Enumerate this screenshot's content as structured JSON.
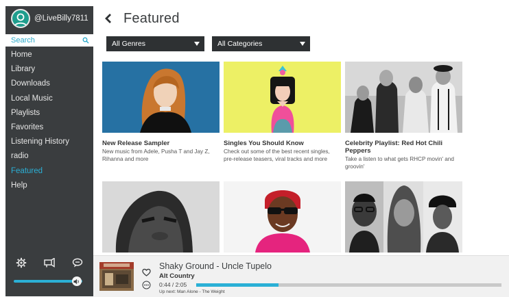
{
  "user": {
    "username": "@LiveBilly7811"
  },
  "search": {
    "placeholder": "Search"
  },
  "sidebar": {
    "items": [
      {
        "label": "Home"
      },
      {
        "label": "Library"
      },
      {
        "label": "Downloads"
      },
      {
        "label": "Local Music"
      },
      {
        "label": "Playlists"
      },
      {
        "label": "Favorites"
      },
      {
        "label": "Listening History"
      },
      {
        "label": "radio"
      },
      {
        "label": "Featured",
        "active": true
      },
      {
        "label": "Help"
      }
    ],
    "bottom_icons": [
      "gear-icon",
      "speaker-icon",
      "chat-icon"
    ],
    "volume": 0.92
  },
  "header": {
    "title": "Featured"
  },
  "filters": {
    "genres": "All Genres",
    "categories": "All Categories"
  },
  "cards": [
    {
      "title": "New Release Sampler",
      "desc": "New music from Adele, Pusha T and Jay Z, Rihanna and more"
    },
    {
      "title": "Singles You Should Know",
      "desc": "Check out some of the best recent singles, pre-release teasers, viral tracks and more"
    },
    {
      "title": "Celebrity Playlist: Red Hot Chili Peppers",
      "desc": "Take a listen to what gets RHCP movin' and groovin'"
    },
    {
      "title": "",
      "desc": ""
    },
    {
      "title": "",
      "desc": ""
    },
    {
      "title": "",
      "desc": ""
    }
  ],
  "player": {
    "song": "Shaky Ground - Uncle Tupelo",
    "genre": "Alt Country",
    "time": "0:44 / 2:05",
    "progress": 0.27,
    "up_next": "Up next: Man Alone - The Weight"
  },
  "colors": {
    "accent": "#2bb0d6",
    "sidebar_bg": "#3a3d3f",
    "dropdown_bg": "#2e3133",
    "avatar": "#1f9d8d"
  }
}
